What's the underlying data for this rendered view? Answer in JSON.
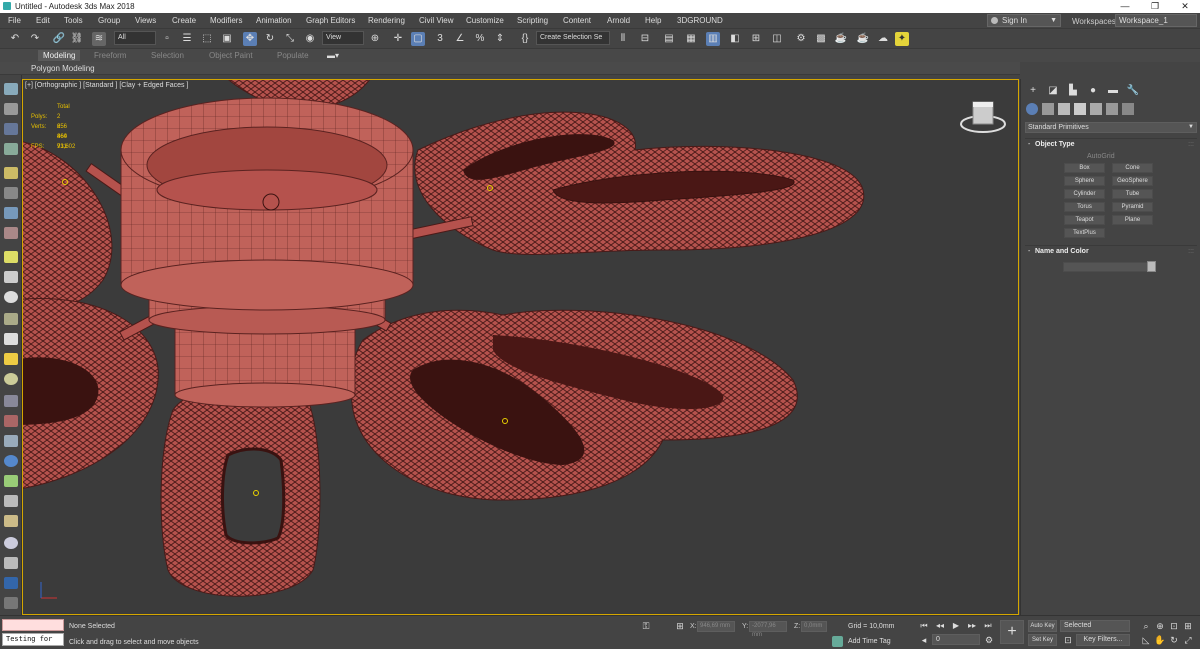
{
  "window": {
    "title": "Untitled - Autodesk 3ds Max 2018",
    "minimize": "—",
    "maximize": "❐",
    "close": "✕"
  },
  "menu": {
    "items": [
      "File",
      "Edit",
      "Tools",
      "Group",
      "Views",
      "Create",
      "Modifiers",
      "Animation",
      "Graph Editors",
      "Rendering",
      "Civil View",
      "Customize",
      "Scripting",
      "Content",
      "Arnold",
      "Help",
      "3DGROUND"
    ],
    "sign_in": "Sign In",
    "workspaces_label": "Workspaces:",
    "workspace_value": "Workspace_1"
  },
  "toolbar": {
    "filter_value": "All",
    "view_value": "View",
    "selection_set_placeholder": "Create Selection Se"
  },
  "ribbon": {
    "tabs": [
      "Modeling",
      "Freeform",
      "Selection",
      "Object Paint",
      "Populate"
    ],
    "active_tab": "Modeling",
    "sub_label": "Polygon Modeling"
  },
  "viewport": {
    "label": "[+] [Orthographic ] [Standard ] [Clay + Edged Faces ]",
    "stats": {
      "total_label": "Total",
      "polys_label": "Polys:",
      "polys_value": "2 656 864",
      "verts_label": "Verts:",
      "verts_value": "2 460 931",
      "fps_label": "FPS:",
      "fps_value": "71,602"
    }
  },
  "command_panel": {
    "category": "Standard Primitives",
    "object_type_title": "Object Type",
    "autogrid_label": "AutoGrid",
    "primitives": [
      "Box",
      "Cone",
      "Sphere",
      "GeoSphere",
      "Cylinder",
      "Tube",
      "Torus",
      "Pyramid",
      "Teapot",
      "Plane",
      "TextPlus"
    ],
    "name_color_title": "Name and Color",
    "rollout_expanded": "-",
    "rollout_dots": ":::"
  },
  "status": {
    "maxscript_input": "Testing for",
    "selection": "None Selected",
    "prompt": "Click and drag to select and move objects",
    "x_label": "X:",
    "x_value": "946,69 mm",
    "y_label": "Y:",
    "y_value": "-2077,96 mm",
    "z_label": "Z:",
    "z_value": "0,0mm",
    "grid": "Grid = 10,0mm",
    "add_time_tag": "Add Time Tag",
    "frame": "0",
    "auto_key": "Auto Key",
    "set_key": "Set Key",
    "key_mode": "Selected",
    "key_filters": "Key Filters..."
  },
  "colors": {
    "accent_yellow": "#d4a600",
    "mesh_red": "#b5524d",
    "viewport_bg": "#3b3b3b"
  }
}
